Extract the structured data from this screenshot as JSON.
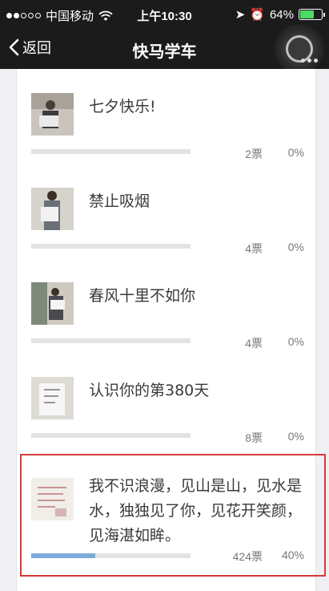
{
  "status_bar": {
    "carrier": "中国移动",
    "time": "上午10:30",
    "battery": "64%",
    "battery_level": 0.64
  },
  "nav": {
    "back_label": "返回",
    "title": "快马学车"
  },
  "poll_items": [
    {
      "title": "七夕快乐!",
      "votes": "2票",
      "percent": "0%",
      "fill": 0.0
    },
    {
      "title": "禁止吸烟",
      "votes": "4票",
      "percent": "0%",
      "fill": 0.0
    },
    {
      "title": "春风十里不如你",
      "votes": "4票",
      "percent": "0%",
      "fill": 0.0
    },
    {
      "title": "认识你的第380天",
      "votes": "8票",
      "percent": "0%",
      "fill": 0.0
    },
    {
      "title": "我不识浪漫，见山是山，见水是水，独独见了你，见花开笑颜，见海湛如眸。",
      "votes": "424票",
      "percent": "40%",
      "fill": 0.4
    }
  ],
  "colors": {
    "bar_fill": "#7eaadb",
    "bar_track": "#e3e3e3",
    "highlight": "#d9393a",
    "battery": "#4cd964"
  }
}
